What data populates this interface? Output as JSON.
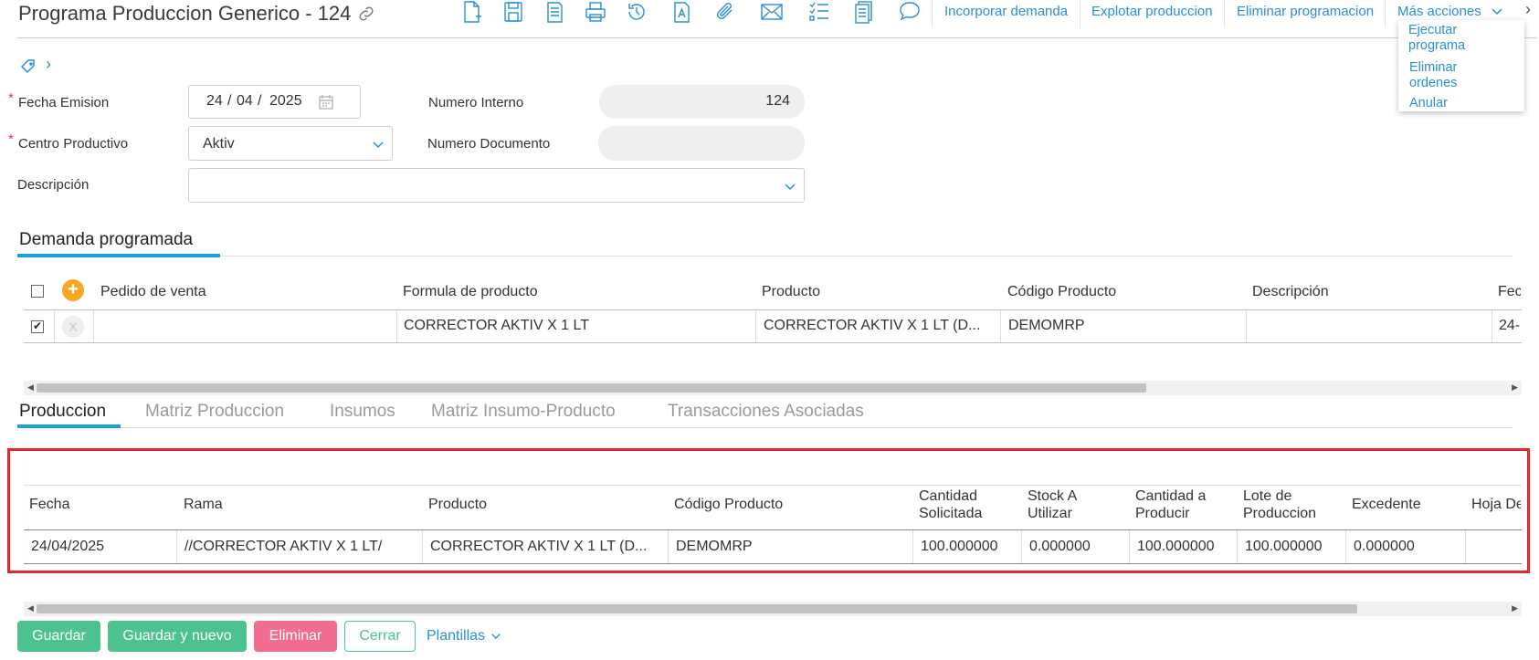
{
  "header": {
    "title": "Programa Produccion Generico - 124",
    "actions": [
      "Incorporar demanda",
      "Explotar produccion",
      "Eliminar programacion",
      "Más acciones"
    ],
    "more_menu": [
      "Ejecutar programa",
      "Eliminar ordenes",
      "Anular"
    ]
  },
  "form": {
    "fecha_emision_label": "Fecha Emision",
    "fecha_day": "24",
    "fecha_month": "04",
    "fecha_year": "2025",
    "numero_interno_label": "Numero Interno",
    "numero_interno_value": "124",
    "centro_label": "Centro Productivo",
    "centro_value": "Aktiv",
    "numero_documento_label": "Numero Documento",
    "numero_documento_value": "",
    "descripcion_label": "Descripción",
    "descripcion_value": "",
    "required_mark": "*"
  },
  "demanda": {
    "title": "Demanda programada",
    "columns": [
      "Pedido de venta",
      "Formula de producto",
      "Producto",
      "Código Producto",
      "Descripción",
      "Fec"
    ],
    "row": {
      "pedido": "",
      "formula": "CORRECTOR AKTIV X 1 LT",
      "producto": "CORRECTOR AKTIV X 1 LT (D...",
      "codigo": "DEMOMRP",
      "descripcion": "",
      "fecha": "24-"
    },
    "row_checked": true
  },
  "tabs": [
    "Produccion",
    "Matriz Produccion",
    "Insumos",
    "Matriz Insumo-Producto",
    "Transacciones Asociadas"
  ],
  "produccion": {
    "columns": [
      "Fecha",
      "Rama",
      "Producto",
      "Código Producto",
      "Cantidad Solicitada",
      "Stock A Utilizar",
      "Cantidad a Producir",
      "Lote de Produccion",
      "Excedente",
      "Hoja De"
    ],
    "row": [
      "24/04/2025",
      "//CORRECTOR AKTIV X 1 LT/",
      "CORRECTOR AKTIV X 1 LT (D...",
      "DEMOMRP",
      "100.000000",
      "0.000000",
      "100.000000",
      "100.000000",
      "0.000000",
      ""
    ]
  },
  "footer": {
    "guardar": "Guardar",
    "guardar_nuevo": "Guardar y nuevo",
    "eliminar": "Eliminar",
    "cerrar": "Cerrar",
    "plantillas": "Plantillas"
  },
  "colors": {
    "accent": "#2a8fd7",
    "tab_underline": "#17a3d7",
    "green": "#4cc38f",
    "danger": "#f06d8f",
    "highlight_frame": "#e0282c"
  }
}
